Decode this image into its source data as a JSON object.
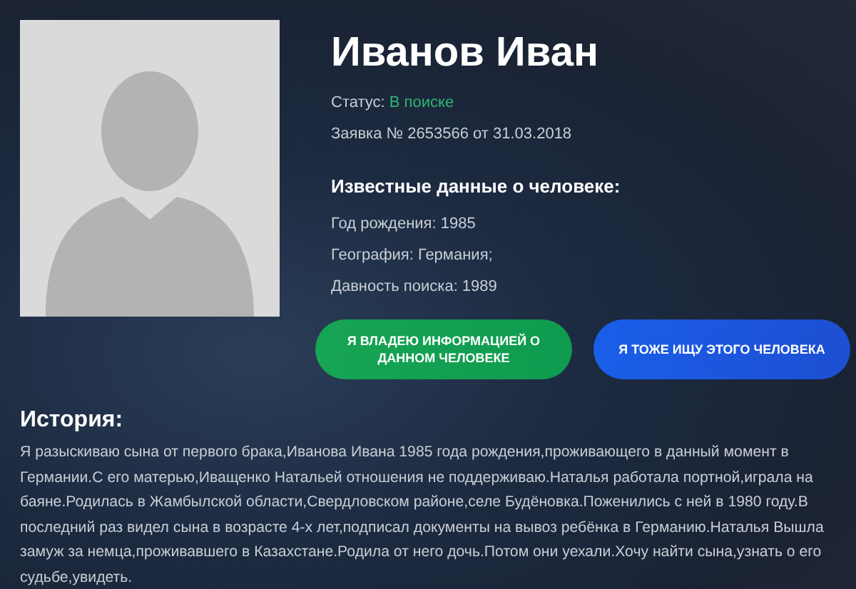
{
  "profile": {
    "name": "Иванов Иван",
    "status": {
      "label": "Статус:",
      "value": "В поиске"
    },
    "application": "Заявка № 2653566 от 31.03.2018",
    "known_heading": "Известные данные о человеке:",
    "facts": [
      "Год рождения: 1985",
      "География: Германия;",
      "Давность поиска: 1989"
    ],
    "buttons": [
      {
        "label": "Я ВЛАДЕЮ ИНФОРМАЦИЕЙ О ДАННОМ ЧЕЛОВЕКЕ",
        "kind": "primary"
      },
      {
        "label": "Я ТОЖЕ ИЩУ ЭТОГО ЧЕЛОВЕКА",
        "kind": "secondary"
      }
    ]
  },
  "history": {
    "title": "История:",
    "text": "Я разыскиваю сына от первого брака,Иванова Ивана 1985 года рождения,проживающего в данный момент в Германии.С его матерью,Иващенко Натальей отношения не поддерживаю.Наталья работала портной,играла на баяне.Родилась в Жамбылской области,Свердловском районе,селе Будёновка.Поженились с ней в 1980 году.В последний раз видел сына в возрасте 4-х лет,подписал документы на вывоз ребёнка в Германию.Наталья Вышла замуж за немца,проживавшего в Казахстане.Родила от него дочь.Потом они уехали.Хочу найти сына,узнать о его судьбе,увидеть."
  }
}
